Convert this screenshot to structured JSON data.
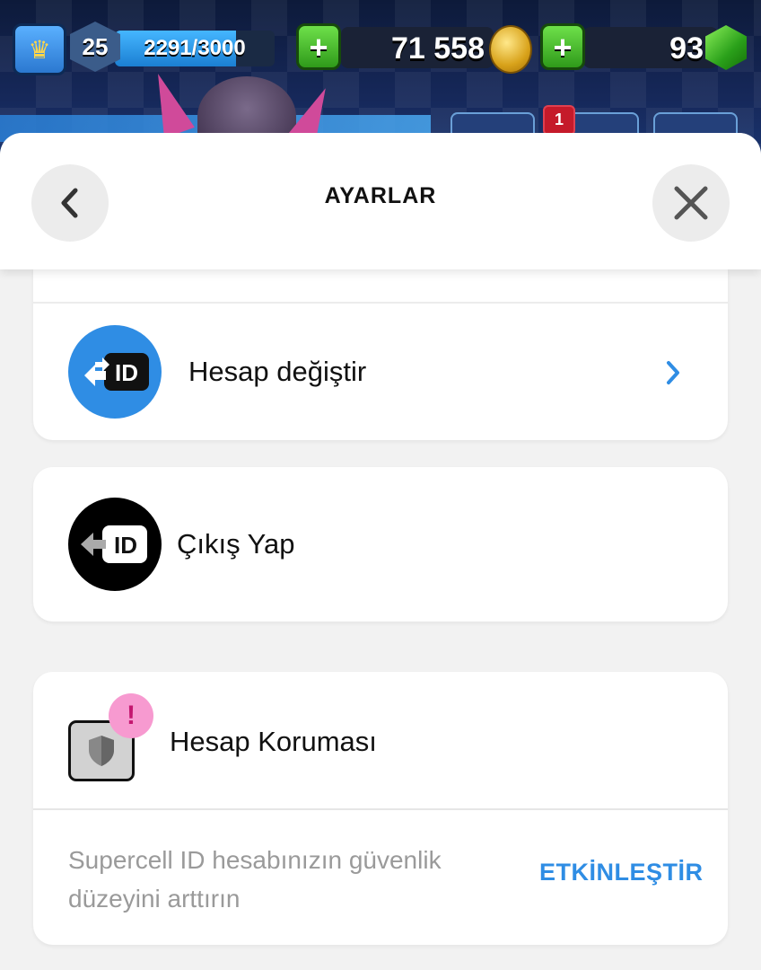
{
  "hud": {
    "level": "25",
    "xp_text": "2291/3000",
    "xp_fraction": 0.76,
    "gold": "71 558",
    "gems": "93",
    "notification_count": "1",
    "plus_label": "+"
  },
  "header": {
    "title": "AYARLAR",
    "back_icon": "chevron-left-icon",
    "close_icon": "close-icon"
  },
  "settings": {
    "switch_account": {
      "label": "Hesap değiştir",
      "icon": "switch-id-icon",
      "id_text": "ID"
    },
    "logout": {
      "label": "Çıkış Yap",
      "icon": "logout-id-icon",
      "id_text": "ID"
    },
    "protection": {
      "title": "Hesap Koruması",
      "alert": "!",
      "description": "Supercell ID hesabınızın güvenlik düzeyini arttırın",
      "action": "ETKİNLEŞTİR"
    }
  },
  "colors": {
    "accent_blue": "#2f8de4",
    "switch_icon_bg": "#2f8de4",
    "logout_icon_bg": "#000000",
    "alert_pink": "#f79ad0",
    "sheet_bg": "#f2f2f2"
  }
}
